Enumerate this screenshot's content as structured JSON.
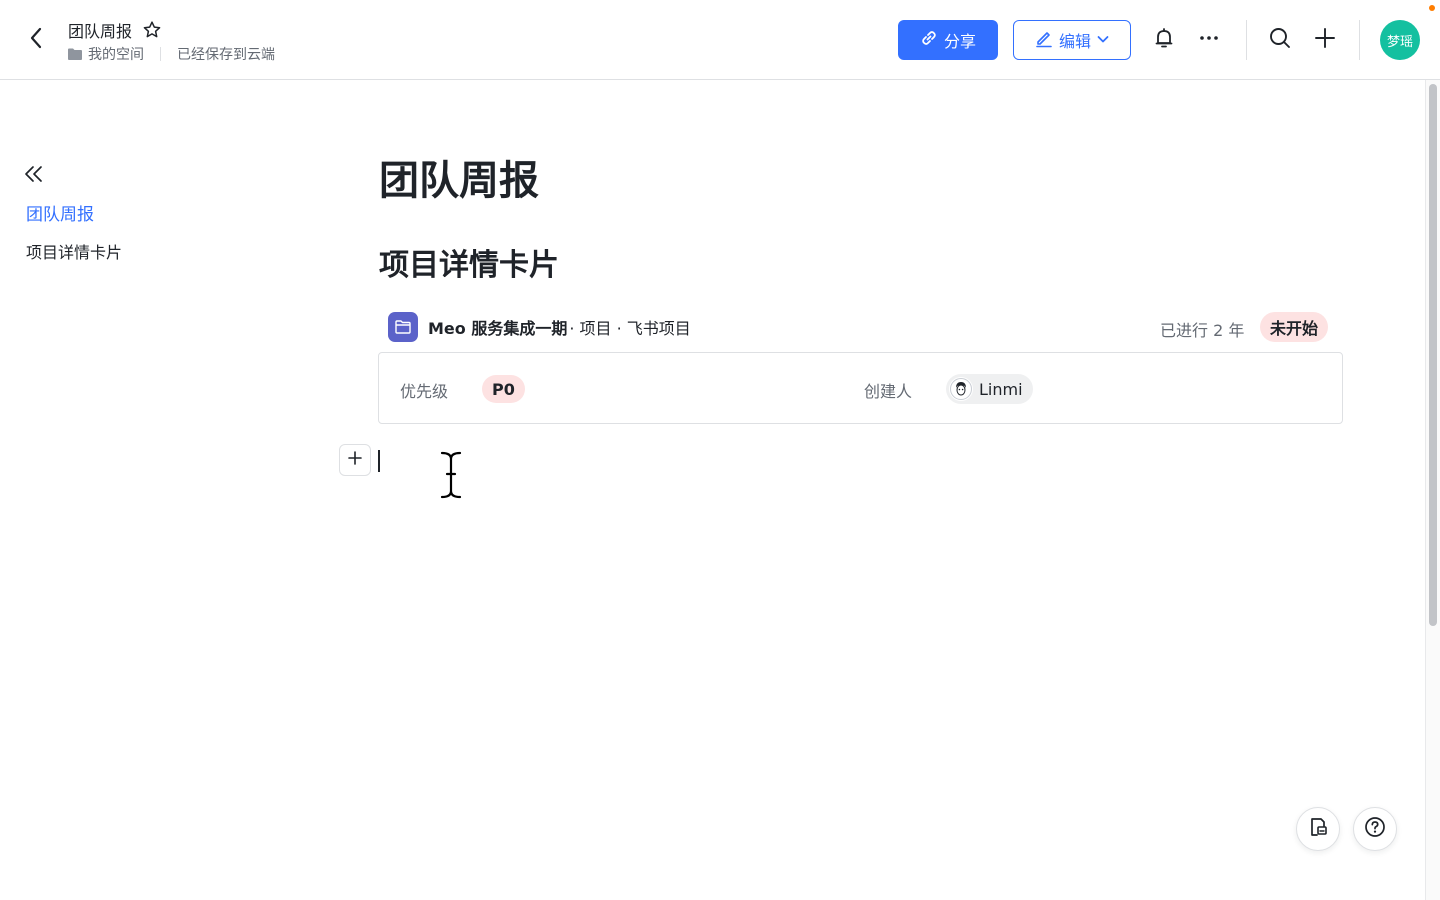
{
  "header": {
    "title": "团队周报",
    "breadcrumb_space": "我的空间",
    "save_status": "已经保存到云端",
    "share_label": "分享",
    "edit_label": "编辑",
    "avatar_text": "梦瑶",
    "icons": [
      "back-arrow-icon",
      "star-icon",
      "folder-icon",
      "link-icon",
      "pencil-icon",
      "chevron-down-icon",
      "bell-icon",
      "more-icon",
      "search-icon",
      "plus-icon"
    ]
  },
  "outline": {
    "items": [
      {
        "label": "团队周报",
        "active": true
      },
      {
        "label": "项目详情卡片",
        "active": false
      }
    ]
  },
  "document": {
    "title": "团队周报",
    "heading": "项目详情卡片",
    "card": {
      "project_name": "Meo 服务集成一期",
      "project_meta": " · 项目 · 飞书项目",
      "elapsed": "已进行 2 年",
      "status": "未开始",
      "fields": [
        {
          "label": "优先级",
          "value": "P0"
        },
        {
          "label": "创建人",
          "value": "Linmi"
        }
      ]
    }
  },
  "colors": {
    "brand": "#3370ff",
    "avatar": "#14c0a0",
    "project_icon": "#5b62c9",
    "status_bg": "#fde2e2",
    "notify_dot": "#ff7d00"
  }
}
